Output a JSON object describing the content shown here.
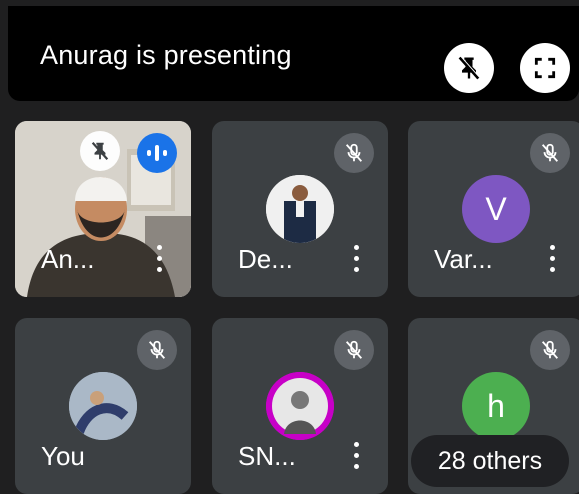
{
  "header": {
    "presenter_text": "Anurag is presenting"
  },
  "tiles": [
    {
      "name": "An...",
      "has_video": true
    },
    {
      "name": "De...",
      "avatar_type": "photo"
    },
    {
      "name": "Var...",
      "avatar_type": "initial",
      "initial": "V",
      "avatar_color": "#7e57c2"
    },
    {
      "name": "You",
      "avatar_type": "photo"
    },
    {
      "name": "SN...",
      "avatar_type": "photo"
    },
    {
      "name": "",
      "avatar_type": "initial",
      "initial": "h",
      "avatar_color": "#4caf50"
    }
  ],
  "others": {
    "label": "28 others"
  },
  "icons": {
    "unpin": "unpin-icon",
    "fullscreen": "fullscreen-icon",
    "mic_off": "mic-off-icon",
    "speaking": "speaking-icon",
    "more": "more-options-icon"
  },
  "colors": {
    "background": "#202124",
    "tile": "#3c4043",
    "speaking_badge": "#1a73e8"
  }
}
